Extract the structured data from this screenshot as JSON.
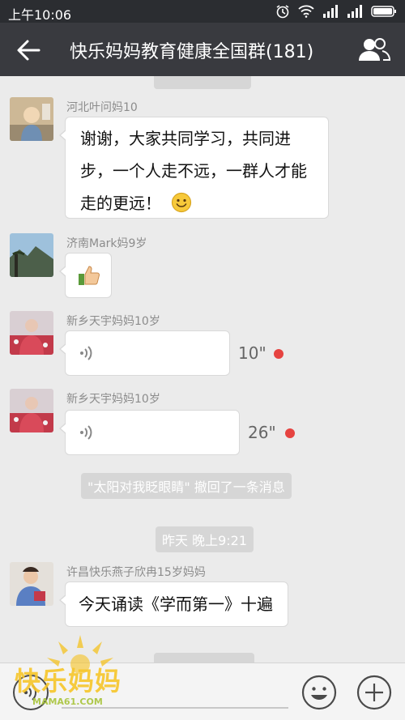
{
  "status_bar": {
    "time": "上午10:06"
  },
  "header": {
    "title": "快乐妈妈教育健康全国群(181)"
  },
  "messages": [
    {
      "sender": "河北叶问妈10",
      "text_line1": "谢谢，大家共同学习，共同进",
      "text_line2": "步，一个人走不远，一群人才能",
      "text_line3": "走的更远！",
      "emoji": "smile-emoji"
    },
    {
      "sender": "济南Mark妈9岁",
      "emoji": "thumbs-up-emoji"
    },
    {
      "sender": "新乡天宇妈妈10岁",
      "voice_duration": "10\""
    },
    {
      "sender": "新乡天宇妈妈10岁",
      "voice_duration": "26\""
    },
    {
      "sender": "许昌快乐燕子欣冉15岁妈妈",
      "text": "今天诵读《学而第一》十遍"
    }
  ],
  "system": {
    "recall_notice": "\"太阳对我眨眼睛\" 撤回了一条消息",
    "timestamp": "昨天 晚上9:21"
  },
  "watermark": {
    "brand": "快乐妈妈",
    "url": "MAMA61.COM"
  },
  "colors": {
    "unread_dot": "#e64340",
    "title_bar": "#393a3f",
    "status_bar": "#2b2d31"
  }
}
